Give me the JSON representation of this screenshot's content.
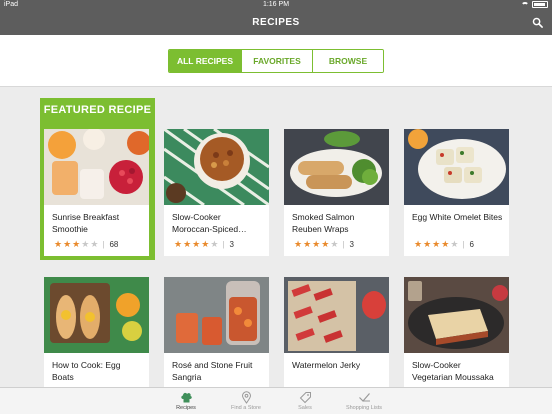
{
  "status": {
    "carrier": "iPad",
    "time": "1:16 PM"
  },
  "header": {
    "title": "RECIPES"
  },
  "segments": [
    {
      "label": "ALL RECIPES",
      "active": true
    },
    {
      "label": "FAVORITES",
      "active": false
    },
    {
      "label": "BROWSE",
      "active": false
    }
  ],
  "featured_label": "FEATURED RECIPE",
  "recipes": [
    {
      "title": "Sunrise Breakfast Smoothie",
      "rating": 3,
      "count": "68"
    },
    {
      "title": "Slow-Cooker Moroccan-Spiced…",
      "rating": 4,
      "count": "3"
    },
    {
      "title": "Smoked Salmon Reuben Wraps",
      "rating": 4,
      "count": "3"
    },
    {
      "title": "Egg White Omelet Bites",
      "rating": 4,
      "count": "6"
    },
    {
      "title": "How to Cook: Egg Boats"
    },
    {
      "title": "Rosé and Stone Fruit Sangria"
    },
    {
      "title": "Watermelon Jerky"
    },
    {
      "title": "Slow-Cooker Vegetarian Moussaka"
    }
  ],
  "tabs": [
    {
      "label": "Recipes",
      "icon": "chef-hat-icon",
      "active": true
    },
    {
      "label": "Find a Store",
      "icon": "map-pin-icon",
      "active": false
    },
    {
      "label": "Sales",
      "icon": "price-tag-icon",
      "active": false
    },
    {
      "label": "Shopping Lists",
      "icon": "checklist-icon",
      "active": false
    }
  ],
  "colors": {
    "accent": "#7cbe31",
    "star": "#e98a2c",
    "bar": "#5d5d5d"
  }
}
